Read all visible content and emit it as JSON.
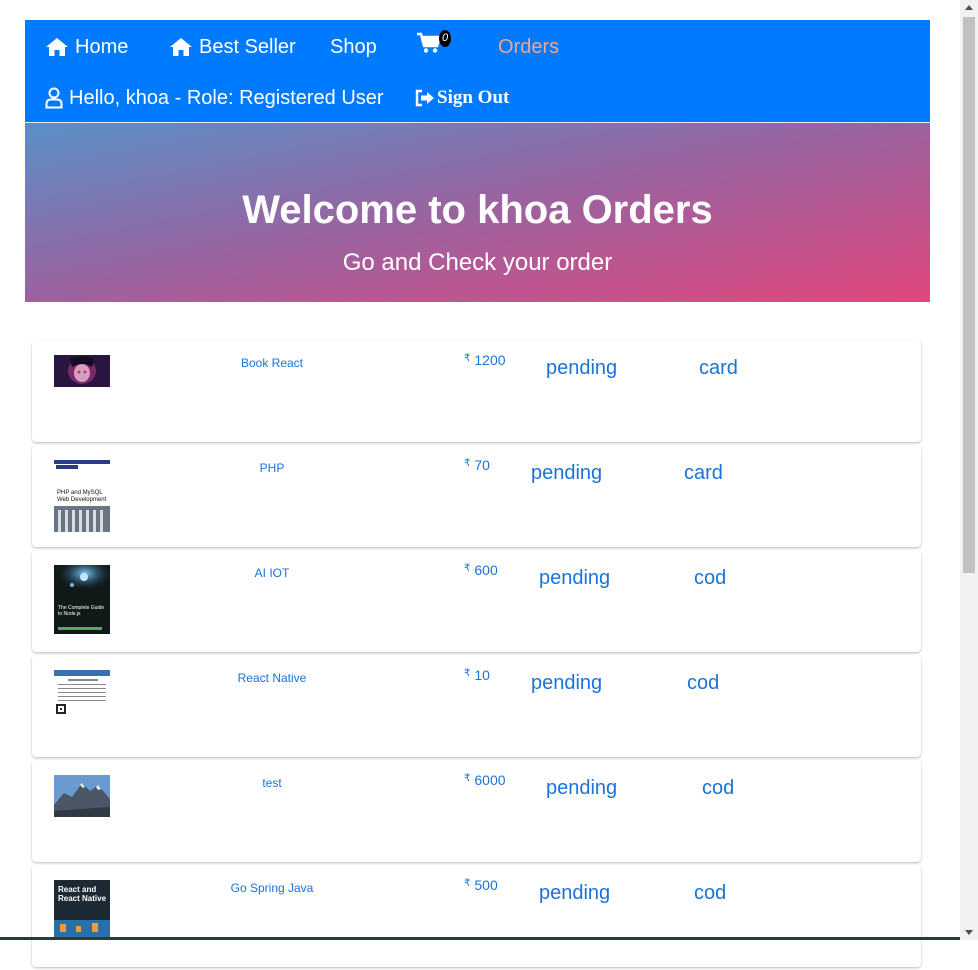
{
  "nav": {
    "home": "Home",
    "best_seller": "Best Seller",
    "shop": "Shop",
    "cart_count": "0",
    "orders": "Orders",
    "hello": "Hello, khoa - Role: Registered User",
    "sign_out": "Sign Out",
    "colors": {
      "bar": "#007bff",
      "active": "#f4a58a"
    }
  },
  "hero": {
    "title": "Welcome to khoa Orders",
    "subtitle": "Go and Check your order"
  },
  "currency_symbol": "₹",
  "orders": [
    {
      "title": "Book React",
      "price": "1200",
      "status": "pending",
      "method": "card",
      "thumb": "anime-cover"
    },
    {
      "title": "PHP",
      "price": "70",
      "status": "pending",
      "method": "card",
      "thumb": "php-mysql-book-cover"
    },
    {
      "title": "AI IOT",
      "price": "600",
      "status": "pending",
      "method": "cod",
      "thumb": "nodejs-book-cover"
    },
    {
      "title": "React Native",
      "price": "10",
      "status": "pending",
      "method": "cod",
      "thumb": "document-scan"
    },
    {
      "title": "test",
      "price": "6000",
      "status": "pending",
      "method": "cod",
      "thumb": "mountain-photo"
    },
    {
      "title": "Go Spring Java",
      "price": "500",
      "status": "pending",
      "method": "cod",
      "thumb": "react-native-book-cover"
    }
  ]
}
